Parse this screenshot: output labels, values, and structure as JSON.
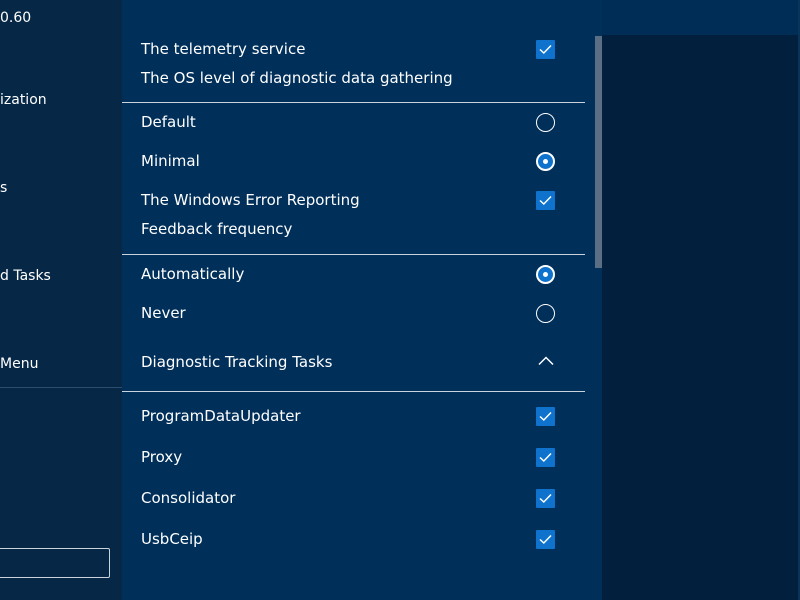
{
  "sidebar": {
    "version": "0.60",
    "items": [
      {
        "label": "ization"
      },
      {
        "label": "s"
      },
      {
        "label": "d Tasks"
      },
      {
        "label": "Menu"
      }
    ],
    "search_value": ""
  },
  "panel": {
    "telemetry": {
      "title": "The telemetry service",
      "checked": true,
      "subtitle": "The OS level of diagnostic data gathering"
    },
    "diagnostic_level": {
      "options": [
        {
          "label": "Default",
          "selected": false
        },
        {
          "label": "Minimal",
          "selected": true
        }
      ]
    },
    "error_reporting": {
      "title": "The Windows Error Reporting",
      "checked": true
    },
    "feedback": {
      "title": "Feedback frequency",
      "options": [
        {
          "label": "Automatically",
          "selected": true
        },
        {
          "label": "Never",
          "selected": false
        }
      ]
    },
    "tracking_tasks": {
      "title": "Diagnostic Tracking Tasks",
      "expanded": true,
      "tasks": [
        {
          "label": "ProgramDataUpdater",
          "checked": true
        },
        {
          "label": "Proxy",
          "checked": true
        },
        {
          "label": "Consolidator",
          "checked": true
        },
        {
          "label": "UsbCeip",
          "checked": true
        }
      ]
    }
  },
  "icons": {
    "check": "checkmark-icon",
    "chevron": "chevron-up-icon"
  },
  "colors": {
    "background": "#02203e",
    "panel": "#002f5a",
    "sidebar": "#062846",
    "accent": "#0f72cd",
    "divider": "#c9d3dd"
  }
}
